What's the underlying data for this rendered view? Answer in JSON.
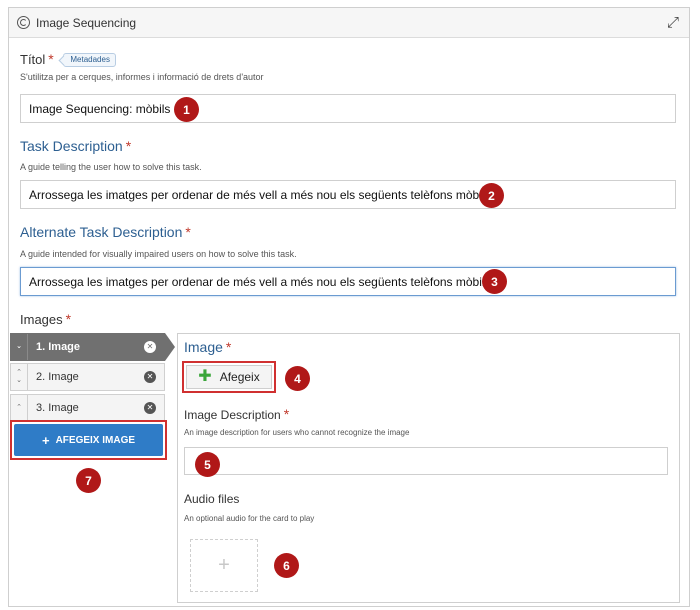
{
  "header": {
    "title": "Image Sequencing"
  },
  "title_field": {
    "label": "Títol",
    "metadata_tag": "Metadades",
    "hint": "S'utilitza per a cerques, informes i informació de drets d'autor",
    "value": "Image Sequencing: mòbils",
    "callout": "1"
  },
  "task_description": {
    "label": "Task Description",
    "hint": "A guide telling the user how to solve this task.",
    "value": "Arrossega les imatges per ordenar de més vell a més nou els següents telèfons mòbils.",
    "callout": "2"
  },
  "alternate_task_description": {
    "label": "Alternate Task Description",
    "hint": "A guide intended for visually impaired users on how to solve this task.",
    "value": "Arrossega les imatges per ordenar de més vell a més nou els següents telèfons mòbils",
    "callout": "3"
  },
  "images": {
    "label": "Images",
    "items": [
      {
        "label": "1. Image",
        "active": true
      },
      {
        "label": "2. Image",
        "active": false
      },
      {
        "label": "3. Image",
        "active": false
      }
    ],
    "add_button": "AFEGEIX IMAGE",
    "add_callout": "7"
  },
  "card": {
    "image_label": "Image",
    "afegeix_button": "Afegeix",
    "afegeix_callout": "4",
    "description_label": "Image Description",
    "description_hint": "An image description for users who cannot recognize the image",
    "description_value": "",
    "description_callout": "5",
    "audio_label": "Audio files",
    "audio_hint": "An optional audio for the card to play",
    "audio_callout": "6"
  },
  "icons": {
    "header_logo": "h5p-logo-icon",
    "expand": "expand-icon",
    "remove": "remove-icon",
    "drag": "drag-handle-icon",
    "plus": "plus-icon"
  },
  "colors": {
    "callout": "#b01818",
    "highlight_border": "#d03030",
    "primary_button": "#2f7cc7",
    "heading_blue": "#2d5f91",
    "required": "#c0392b",
    "add_plus": "#3aa63a"
  }
}
